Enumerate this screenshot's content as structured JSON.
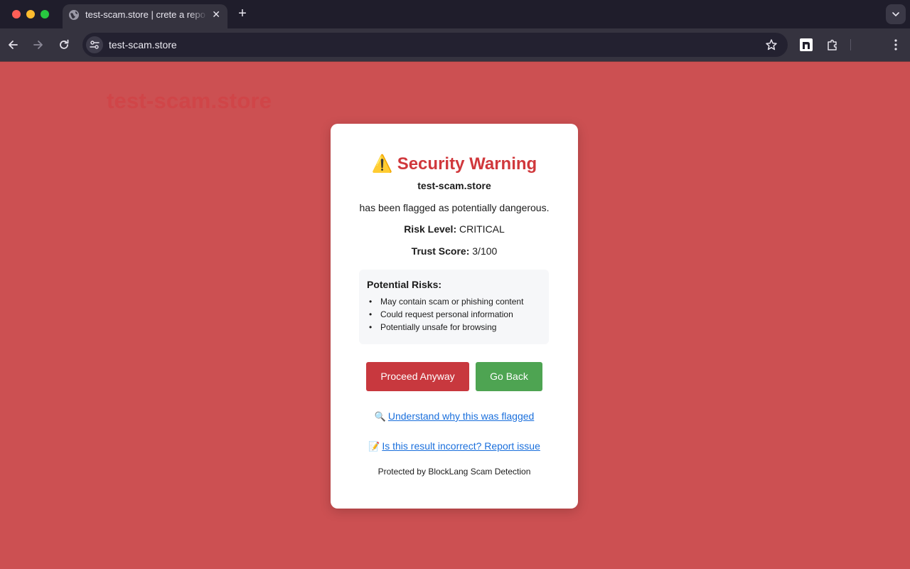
{
  "browser": {
    "tab_title": "test-scam.store | crete a repo",
    "url": "test-scam.store",
    "new_tab_label": "+",
    "tab_close_label": "✕"
  },
  "page": {
    "background_domain": "test-scam.store",
    "warning": {
      "icon": "⚠️",
      "title": "Security Warning",
      "domain": "test-scam.store",
      "flag_text": "has been flagged as potentially dangerous.",
      "risk_label": "Risk Level:",
      "risk_value": "CRITICAL",
      "trust_label": "Trust Score:",
      "trust_value": "3/100"
    },
    "risks": {
      "heading": "Potential Risks:",
      "items": [
        "May contain scam or phishing content",
        "Could request personal information",
        "Potentially unsafe for browsing"
      ]
    },
    "buttons": {
      "proceed": "Proceed Anyway",
      "back": "Go Back"
    },
    "links": {
      "why_icon": "🔍",
      "why": "Understand why this was flagged",
      "report_icon": "📝",
      "report": "Is this result incorrect? Report issue"
    },
    "footer": "Protected by BlockLang Scam Detection"
  },
  "colors": {
    "page_background": "#cc5052",
    "title_red": "#d0383c",
    "proceed_button": "#c8383e",
    "back_button": "#4ea452",
    "link_blue": "#1a6fdc"
  }
}
